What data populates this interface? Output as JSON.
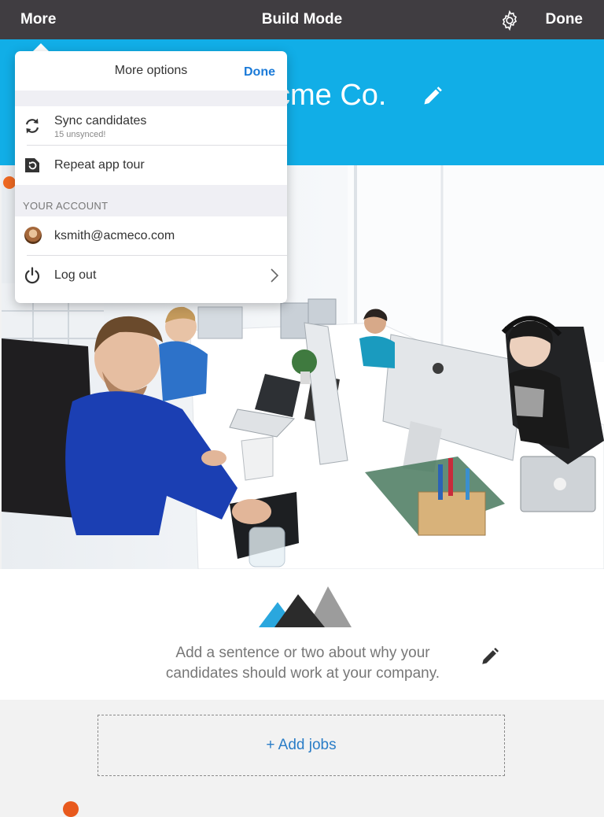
{
  "nav": {
    "left_label": "More",
    "title": "Build Mode",
    "right_label": "Done",
    "gear_icon": "gear-icon"
  },
  "company": {
    "name_visible": "cme Co.",
    "edit_icon": "pencil-icon"
  },
  "popover": {
    "title": "More options",
    "done_label": "Done",
    "items": [
      {
        "label": "Sync candidates",
        "sublabel": "15 unsynced!",
        "icon": "sync-icon"
      },
      {
        "label": "Repeat app tour",
        "icon": "tour-icon"
      }
    ],
    "account_section_label": "YOUR ACCOUNT",
    "account_items": [
      {
        "label": "ksmith@acmeco.com",
        "icon": "avatar"
      },
      {
        "label": "Log out",
        "icon": "power-icon",
        "accessory": "chevron-right-icon"
      }
    ]
  },
  "about": {
    "text": "Add a sentence or two about why your candidates should work at your company.",
    "edit_icon": "pencil-icon"
  },
  "jobs": {
    "add_label": "+ Add jobs"
  },
  "colors": {
    "nav_bg": "#403d41",
    "hero_bg": "#11aee7",
    "link_blue": "#1a7ad8",
    "accent_orange": "#e8591d"
  }
}
